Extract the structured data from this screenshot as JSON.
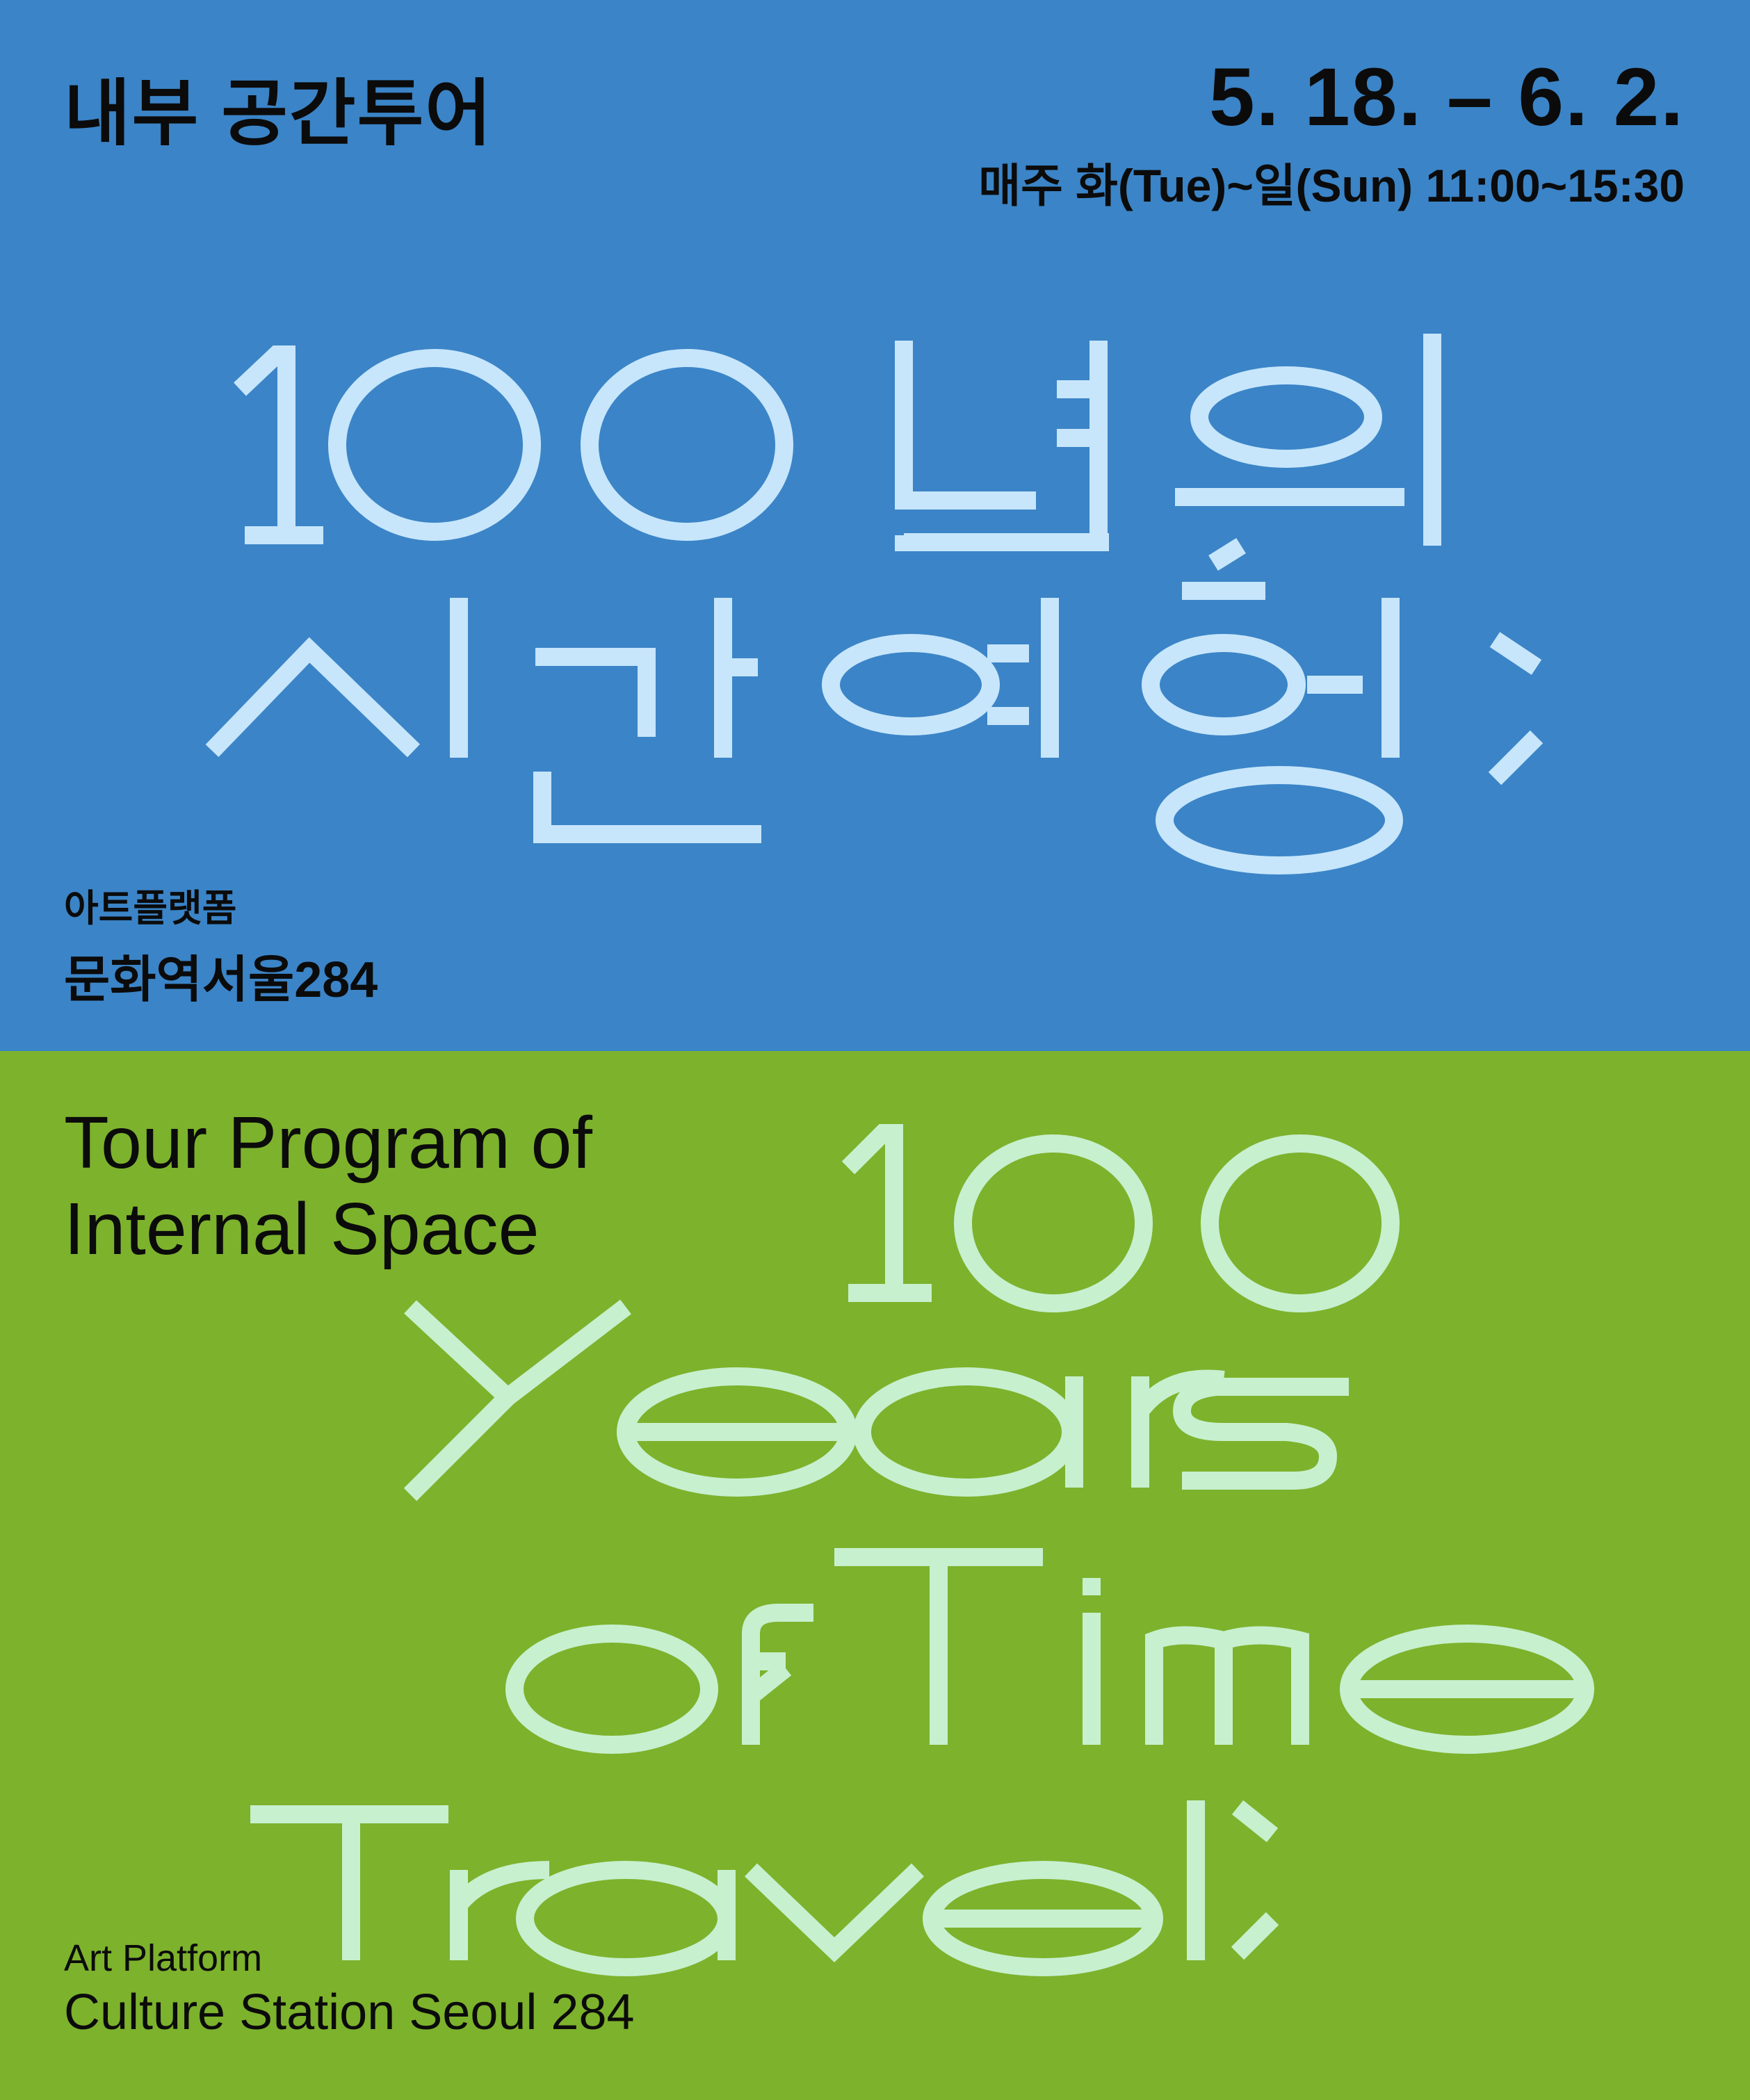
{
  "poster": {
    "korean": {
      "program_title": "내부 공간투어",
      "date_range": "5. 18. – 6. 2.",
      "schedule": "매주 화(Tue)~일(Sun) 11:00~15:30",
      "display_title": "100년의 시간여행;",
      "venue_small": "아트플랫폼",
      "venue_big": "문화역서울284"
    },
    "english": {
      "program_title_line1": "Tour Program of",
      "program_title_line2": "Internal Space",
      "display_title": "100 Years of Time Travel;",
      "venue_small": "Art Platform",
      "venue_big": "Culture Station Seoul 284"
    },
    "colors": {
      "top_background": "#3b84c7",
      "bottom_background": "#7db22c",
      "top_display_text": "#c7e6fb",
      "bottom_display_text": "#c7f0cf",
      "body_text": "#0b0b0b"
    }
  }
}
